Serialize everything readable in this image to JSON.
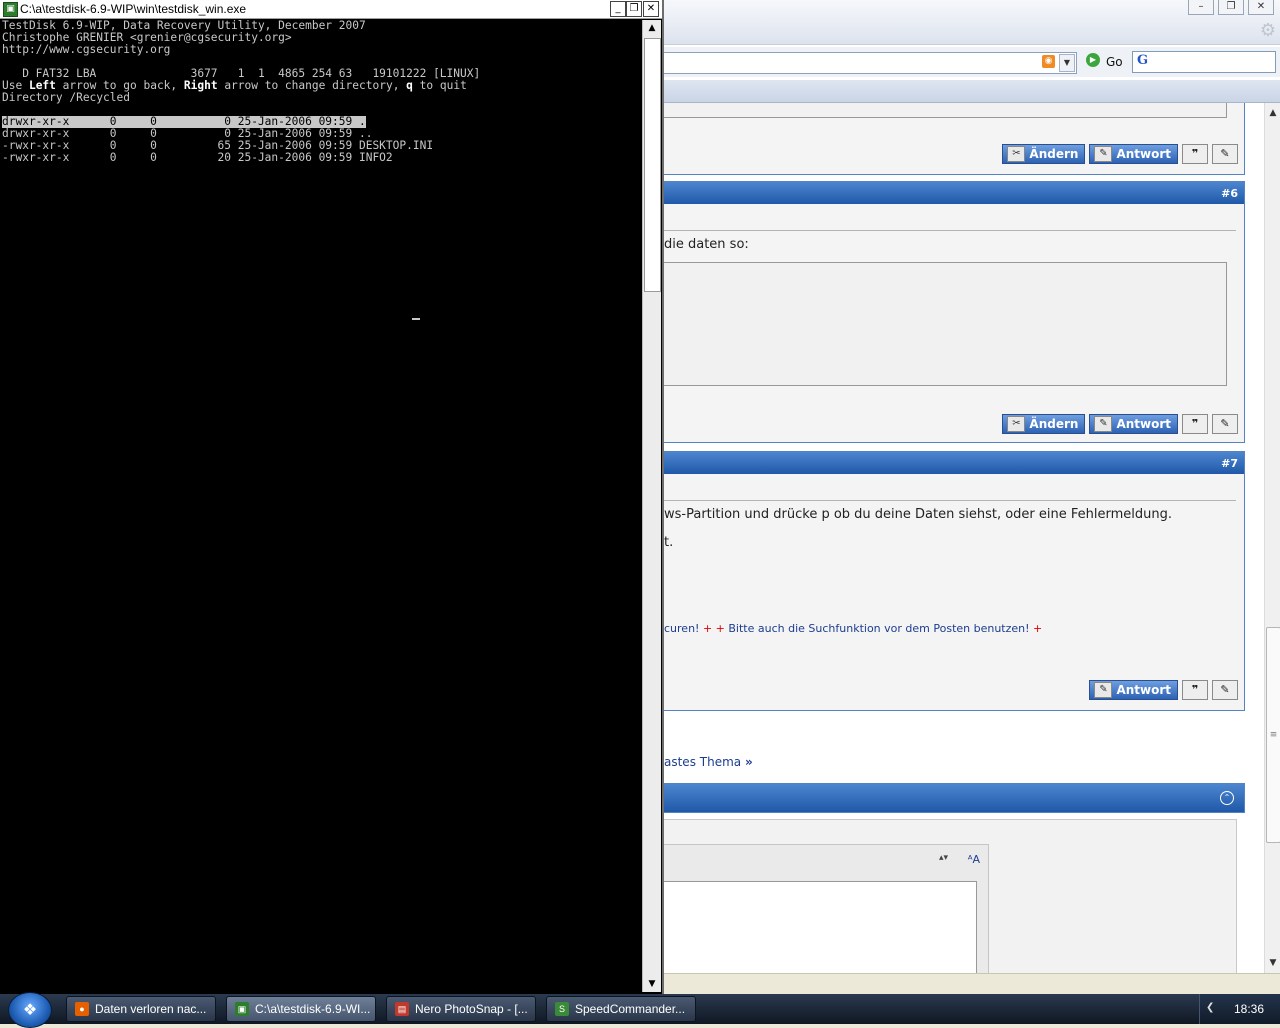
{
  "console": {
    "title": "C:\\a\\testdisk-6.9-WIP\\win\\testdisk_win.exe",
    "lines": {
      "l1": "TestDisk 6.9-WIP, Data Recovery Utility, December 2007",
      "l2": "Christophe GRENIER <grenier@cgsecurity.org>",
      "l3": "http://www.cgsecurity.org",
      "partition": "   D FAT32 LBA              3677   1  1  4865 254 63   19101222 [LINUX]",
      "help_pre": "Use ",
      "help_left": "Left",
      "help_mid": " arrow to go back, ",
      "help_right": "Right",
      "help_mid2": " arrow to change directory, ",
      "help_q": "q",
      "help_post": " to quit",
      "directory": "Directory /Recycled"
    },
    "files": [
      {
        "perms": "drwxr-xr-x",
        "uid": "0",
        "gid": "0",
        "size": "0",
        "date": "25-Jan-2006 09:59",
        "name": "."
      },
      {
        "perms": "drwxr-xr-x",
        "uid": "0",
        "gid": "0",
        "size": "0",
        "date": "25-Jan-2006 09:59",
        "name": ".."
      },
      {
        "perms": "-rwxr-xr-x",
        "uid": "0",
        "gid": "0",
        "size": "65",
        "date": "25-Jan-2006 09:59",
        "name": "DESKTOP.INI"
      },
      {
        "perms": "-rwxr-xr-x",
        "uid": "0",
        "gid": "0",
        "size": "20",
        "date": "25-Jan-2006 09:59",
        "name": "INFO2"
      }
    ],
    "row_text": [
      "drwxr-xr-x      0     0          0 25-Jan-2006 09:59 .",
      "drwxr-xr-x      0     0          0 25-Jan-2006 09:59 ..",
      "-rwxr-xr-x      0     0         65 25-Jan-2006 09:59 DESKTOP.INI",
      "-rwxr-xr-x      0     0         20 25-Jan-2006 09:59 INFO2"
    ],
    "selected_index": 0
  },
  "browser": {
    "go_label": "Go",
    "search_logo": "G",
    "post6": {
      "number": "#6",
      "text": "die daten so:",
      "buttons": {
        "edit": "Ändern",
        "reply": "Antwort"
      }
    },
    "post5_buttons": {
      "edit": "Ändern",
      "reply": "Antwort"
    },
    "post7": {
      "number": "#7",
      "text1": "ws-Partition und drücke p ob du deine Daten siehst, oder eine Fehlermeldung.",
      "text2": "t.",
      "sig_start": "curen!",
      "sig_plus1": "+",
      "sig_plus2": "+",
      "sig_mid": "Bitte auch die Suchfunktion vor dem Posten benutzen!",
      "sig_plus3": "+",
      "buttons": {
        "reply": "Antwort"
      }
    },
    "next_thread": "astes Thema",
    "next_arrow": "»"
  },
  "taskbar": {
    "tasks": [
      {
        "label": "Daten verloren nac...",
        "icon": "firefox-icon",
        "color": "#e66000"
      },
      {
        "label": "C:\\a\\testdisk-6.9-WI...",
        "icon": "console-icon",
        "color": "#2d7d2d"
      },
      {
        "label": "Nero PhotoSnap - [...",
        "icon": "photosnap-icon",
        "color": "#c0392b"
      },
      {
        "label": "SpeedCommander...",
        "icon": "speedcommander-icon",
        "color": "#3a8a3a"
      }
    ],
    "clock": "18:36"
  }
}
